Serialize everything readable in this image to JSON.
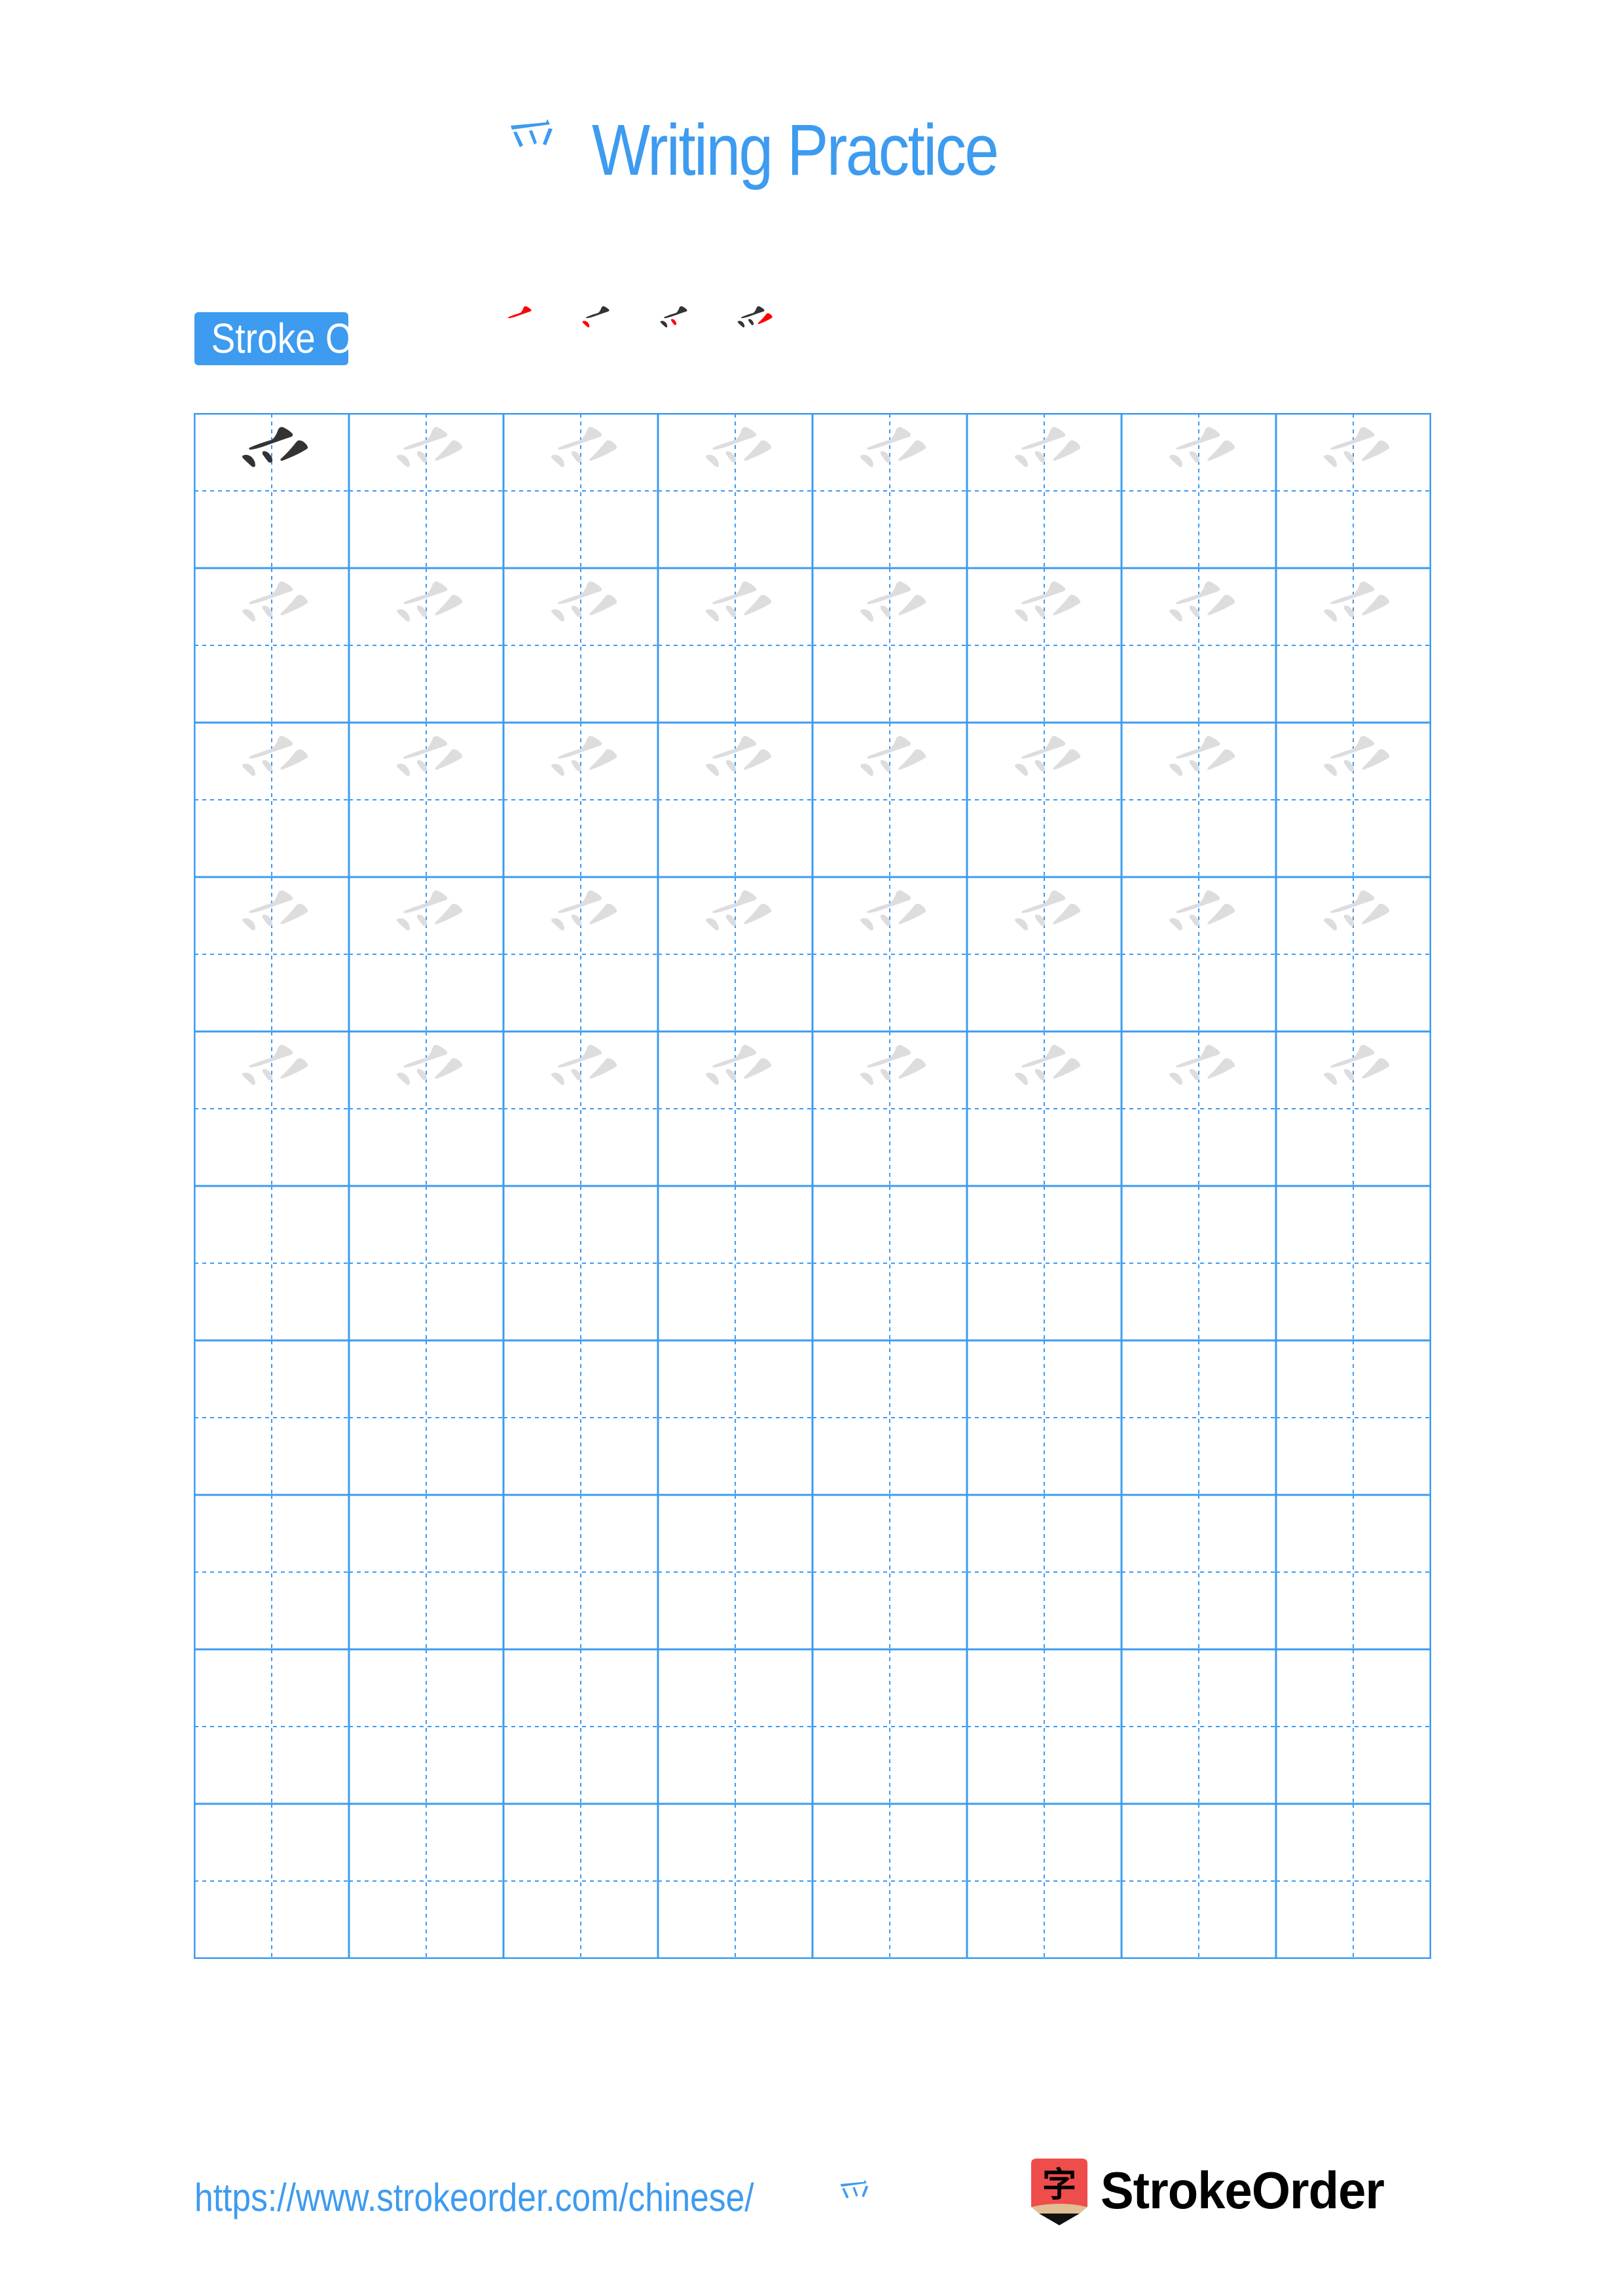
{
  "page": {
    "character": "⺤",
    "title": {
      "character": "⺤",
      "text": "Writing Practice"
    },
    "stroke_order": {
      "label": "Stroke Order",
      "stroke_count": 4,
      "steps": [
        {
          "step": 1,
          "highlight_stroke": 1
        },
        {
          "step": 2,
          "highlight_stroke": 2
        },
        {
          "step": 3,
          "highlight_stroke": 3
        },
        {
          "step": 4,
          "highlight_stroke": 4
        }
      ]
    },
    "grid": {
      "rows": 10,
      "columns": 8,
      "model_cells": 1,
      "trace_rows": 5,
      "empty_rows": 5
    },
    "footer": {
      "url_text": "https://www.strokeorder.com/chinese/",
      "url_character": "⺤",
      "logo_icon_character": "字",
      "logo_text": "StrokeOrder"
    },
    "colors": {
      "accent": "#3d9bf0",
      "model_stroke": "#333333",
      "trace_stroke": "#dddddd",
      "highlight_stroke": "#ff0000",
      "logo_red": "#ef4c4c",
      "logo_tan": "#dfbf95",
      "logo_text": "#000000"
    }
  }
}
